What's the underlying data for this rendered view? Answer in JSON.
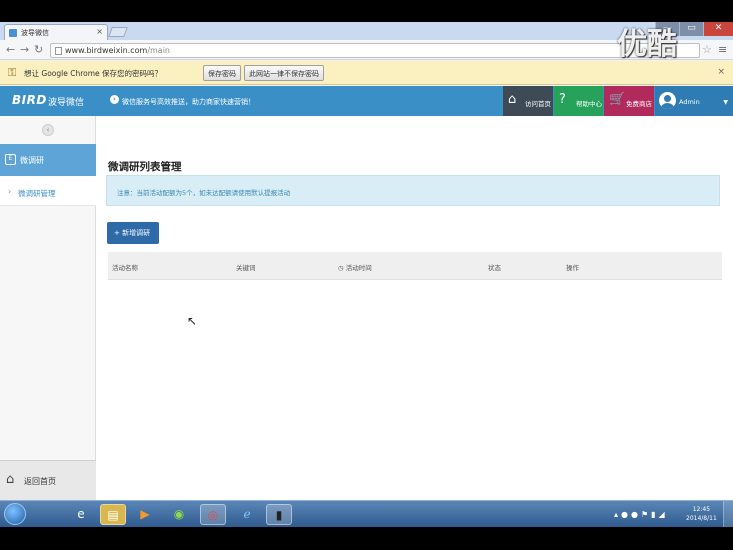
{
  "browser": {
    "tab_title": "波导微信",
    "tab_close": "×",
    "url_host": "www.birdweixin.com",
    "url_path": "/main",
    "window_controls": {
      "minimize": "—",
      "maximize": "▭",
      "close": "✕"
    }
  },
  "infobar": {
    "message": "想让 Google Chrome 保存您的密码吗？",
    "save_label": "保存密码",
    "never_label": "此网站一律不保存密码",
    "close": "×"
  },
  "app": {
    "logo": "BIRD",
    "logo_sub": "波导微信",
    "notice": "微信服务号高效推送，助力商家快速营销！",
    "header_buttons": {
      "home": "访问首页",
      "help": "帮助中心",
      "shop": "免费商店",
      "user": "Admin"
    }
  },
  "sidebar": {
    "collapse": "‹",
    "section_icon": "E",
    "section_label": "微调研",
    "items": [
      {
        "label": "微调研管理"
      }
    ],
    "back_label": "返回首页"
  },
  "main": {
    "title": "微调研列表管理",
    "alert": "注意：当前活动配额为5个，如未达配额请使用默认提报活动",
    "add_button": "+ 新增调研",
    "columns": [
      "活动名称",
      "关键词",
      "◷ 活动时间",
      "状态",
      "操作"
    ]
  },
  "taskbar": {
    "clock_time": "12:45",
    "clock_date": "2014/8/11"
  },
  "watermark": "优酷",
  "icons": {
    "back": "back-arrow-icon",
    "forward": "forward-arrow-icon",
    "reload": "reload-icon",
    "star": "star-icon",
    "wrench": "wrench-icon",
    "key": "key-icon",
    "home": "home-icon",
    "help": "question-icon",
    "cart": "cart-icon"
  },
  "colors": {
    "header_blue": "#3b8fc7",
    "home_btn": "#3e4a56",
    "help_btn": "#27a25b",
    "shop_btn": "#b02a5b",
    "sidebar_section": "#5fa4d6",
    "alert_bg": "#d9edf7",
    "primary_button": "#2e6aa8"
  }
}
